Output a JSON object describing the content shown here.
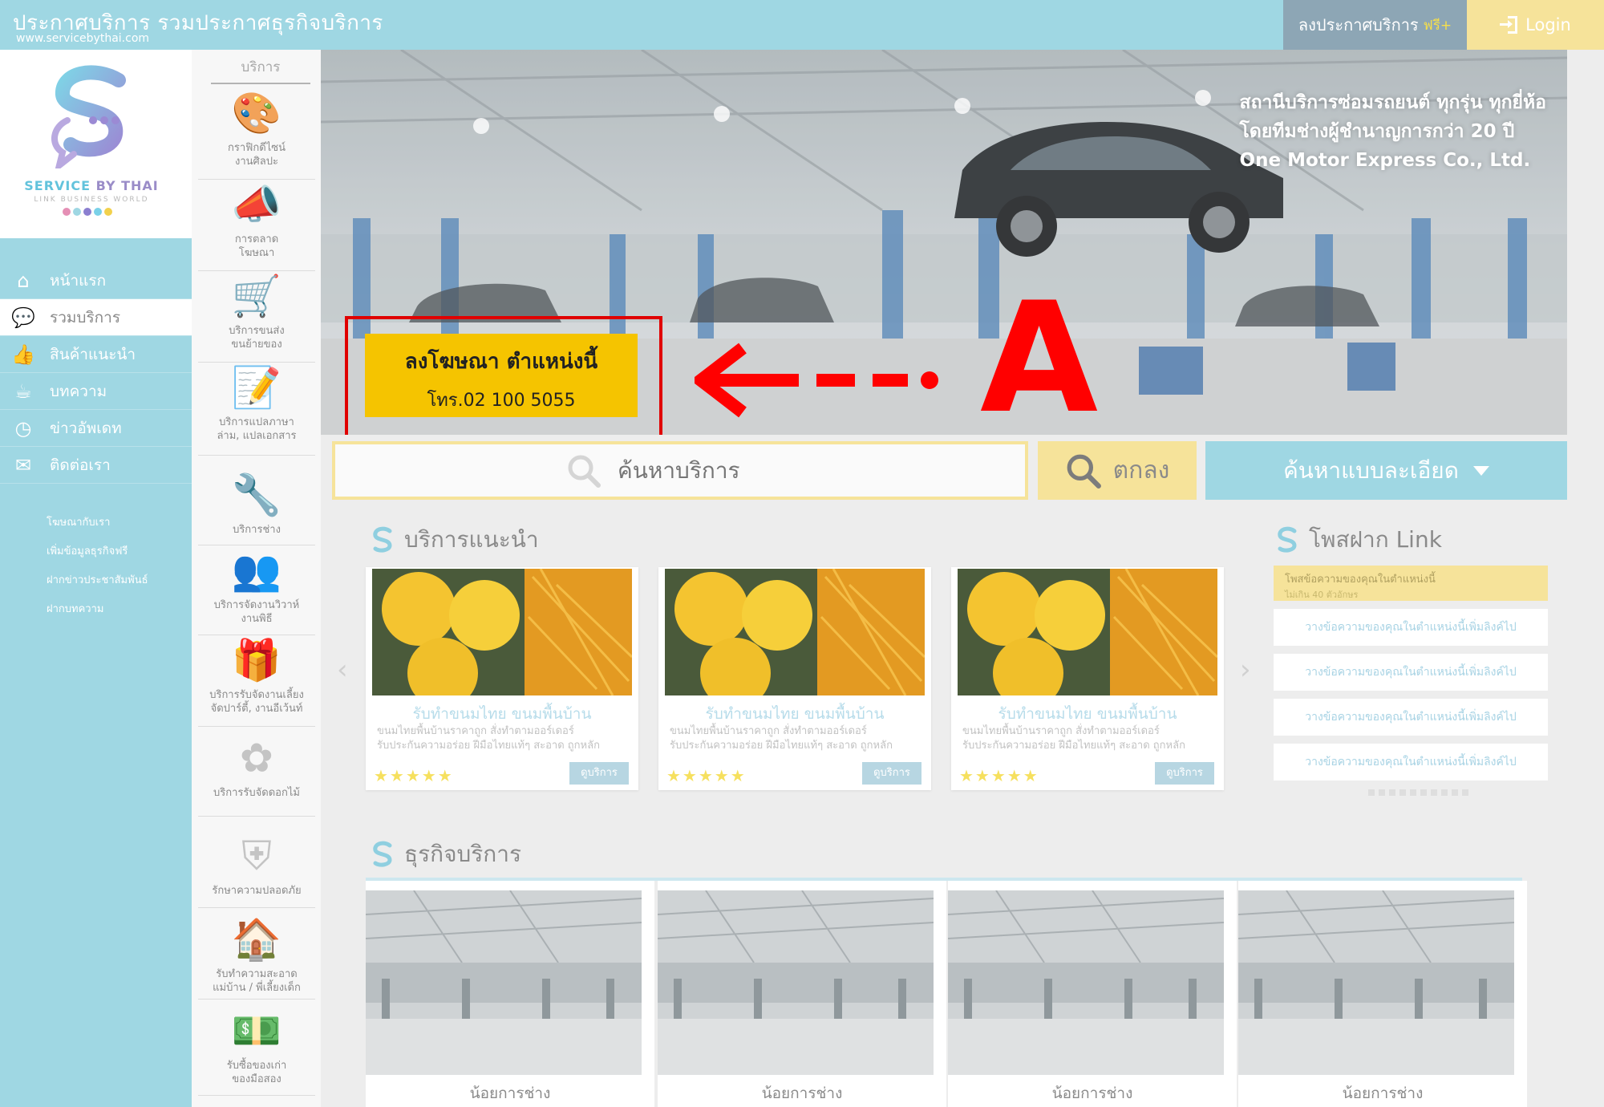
{
  "topbar": {
    "site_title": "ประกาศบริการ รวมประกาศธุรกิจบริการ",
    "site_url": "www.servicebythai.com",
    "post_label": "ลงประกาศบริการ",
    "post_free": "ฟรี+",
    "login_label": "Login"
  },
  "logo": {
    "name_service": "SERVICE",
    "name_by": " BY THAI",
    "tagline": "LINK BUSINESS WORLD",
    "dot_colors": [
      "#e58fb5",
      "#9fd7e3",
      "#8b7fd0",
      "#7ad1e8",
      "#f2d14c"
    ]
  },
  "nav": {
    "items": [
      {
        "label": "หน้าแรก",
        "icon": "home-icon"
      },
      {
        "label": "รวมบริการ",
        "icon": "chat-icon"
      },
      {
        "label": "สินค้าแนะนำ",
        "icon": "thumbs-up-icon"
      },
      {
        "label": "บทความ",
        "icon": "coffee-icon"
      },
      {
        "label": "ข่าวอัพเดท",
        "icon": "clock-icon"
      },
      {
        "label": "ติดต่อเรา",
        "icon": "contact-icon"
      }
    ],
    "sub_links": [
      "โฆษณากับเรา",
      "เพิ่มข้อมูลธุรกิจฟรี",
      "ฝากข่าวประชาสัมพันธ์",
      "ฝากบทความ"
    ]
  },
  "categories": {
    "header": "บริการ",
    "items": [
      {
        "label": "กราฟิกดีไซน์\nงานศิลปะ",
        "icon": "palette-icon"
      },
      {
        "label": "การตลาด\nโฆษณา",
        "icon": "megaphone-icon"
      },
      {
        "label": "บริการขนส่ง\nขนย้ายของ",
        "icon": "truck-icon"
      },
      {
        "label": "บริการแปลภาษา\nล่าม, แปลเอกสาร",
        "icon": "document-pen-icon"
      },
      {
        "label": "บริการช่าง",
        "icon": "tools-icon"
      },
      {
        "label": "บริการจัดงานวิวาห์\nงานพิธี",
        "icon": "couple-icon"
      },
      {
        "label": "บริการรับจัดงานเลี้ยง\nจัดปาร์ตี้, งานอีเว้นท์",
        "icon": "gift-icon"
      },
      {
        "label": "บริการรับจัดดอกไม้",
        "icon": "flower-icon"
      },
      {
        "label": "รักษาความปลอดภัย",
        "icon": "shield-icon"
      },
      {
        "label": "รับทำความสะอาด\nแม่บ้าน / พี่เลี้ยงเด็ก",
        "icon": "house-hand-icon"
      },
      {
        "label": "รับซื้อของเก่า\nของมือสอง",
        "icon": "money-icon"
      }
    ]
  },
  "hero": {
    "caption_lines": [
      "สถานีบริการซ่อมรถยนต์ ทุกรุ่น ทุกยี่ห้อ",
      "โดยทีมช่างผู้ชำนาญการกว่า 20 ปี",
      "One Motor Express Co., Ltd."
    ],
    "ad_line1": "ลงโฆษณา ตำแหน่งนี้",
    "ad_line2": "โทร.02 100 5055",
    "marker_letter": "A",
    "marker_color": "#ff0000"
  },
  "search": {
    "placeholder": "ค้นหาบริการ",
    "submit_label": "ตกลง",
    "advanced_label": "ค้นหาแบบละเอียด"
  },
  "recommended": {
    "title": "บริการแนะนำ",
    "cards": [
      {
        "title": "รับทำขนมไทย ขนมพื้นบ้าน",
        "desc": "ขนมไทยพื้นบ้านราคาถูก สั่งทำตามออร์เดอร์\nรับประกันความอร่อย ฝีมือไทยแท้ๆ สะอาด ถูกหลัก",
        "stars": "★★★★★",
        "button": "ดูบริการ"
      },
      {
        "title": "รับทำขนมไทย ขนมพื้นบ้าน",
        "desc": "ขนมไทยพื้นบ้านราคาถูก สั่งทำตามออร์เดอร์\nรับประกันความอร่อย ฝีมือไทยแท้ๆ สะอาด ถูกหลัก",
        "stars": "★★★★★",
        "button": "ดูบริการ"
      },
      {
        "title": "รับทำขนมไทย ขนมพื้นบ้าน",
        "desc": "ขนมไทยพื้นบ้านราคาถูก สั่งทำตามออร์เดอร์\nรับประกันความอร่อย ฝีมือไทยแท้ๆ สะอาด ถูกหลัก",
        "stars": "★★★★★",
        "button": "ดูบริการ"
      }
    ]
  },
  "post_link": {
    "title": "โพสฝาก Link",
    "highlight_line1": "โพสข้อความของคุณในตำแหน่งนี้",
    "highlight_line2": "ไม่เกิน 40 ตัวอักษร",
    "rows": [
      "วางข้อความของคุณในตำแหน่งนี้เพิ่มลิงค์ไป",
      "วางข้อความของคุณในตำแหน่งนี้เพิ่มลิงค์ไป",
      "วางข้อความของคุณในตำแหน่งนี้เพิ่มลิงค์ไป",
      "วางข้อความของคุณในตำแหน่งนี้เพิ่มลิงค์ไป"
    ]
  },
  "business": {
    "title": "ธุรกิจบริการ",
    "cards": [
      {
        "title": "น้อยการช่าง"
      },
      {
        "title": "น้อยการช่าง"
      },
      {
        "title": "น้อยการช่าง"
      },
      {
        "title": "น้อยการช่าง"
      }
    ]
  }
}
